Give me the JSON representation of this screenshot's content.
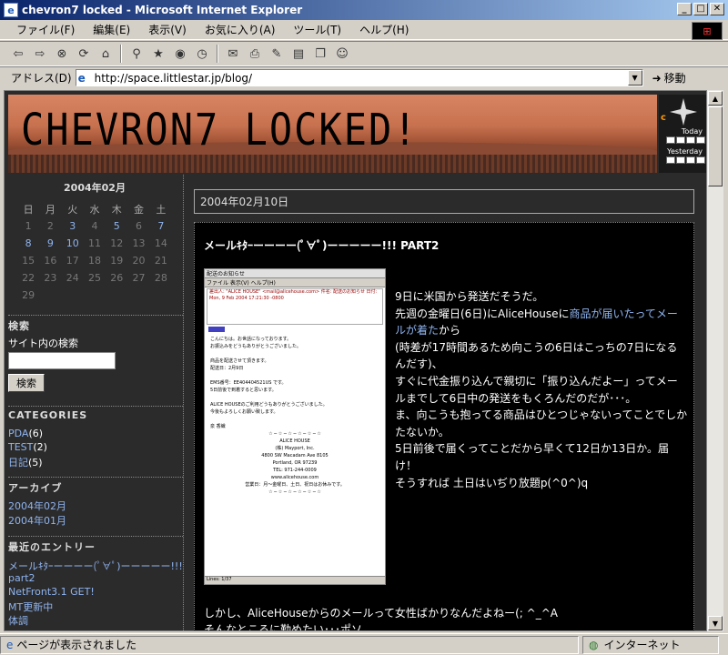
{
  "window": {
    "title": "chevron7 locked - Microsoft Internet Explorer"
  },
  "menu": [
    "ファイル(F)",
    "編集(E)",
    "表示(V)",
    "お気に入り(A)",
    "ツール(T)",
    "ヘルプ(H)"
  ],
  "address": {
    "label": "アドレス(D)",
    "url": "http://space.littlestar.jp/blog/",
    "go": "移動"
  },
  "blog": {
    "title": "CHEVRON7 LOCKED!",
    "counter_today": "Today",
    "counter_yesterday": "Yesterday",
    "calendar": {
      "title": "2004年02月",
      "weekdays": [
        "日",
        "月",
        "火",
        "水",
        "木",
        "金",
        "土"
      ],
      "weeks": [
        [
          "1",
          "2",
          "3",
          "4",
          "5",
          "6",
          "7"
        ],
        [
          "8",
          "9",
          "10",
          "11",
          "12",
          "13",
          "14"
        ],
        [
          "15",
          "16",
          "17",
          "18",
          "19",
          "20",
          "21"
        ],
        [
          "22",
          "23",
          "24",
          "25",
          "26",
          "27",
          "28"
        ],
        [
          "29",
          "",
          "",
          "",
          "",
          "",
          ""
        ]
      ],
      "linked_days": [
        "3",
        "5",
        "7",
        "8",
        "9",
        "10"
      ]
    },
    "search": {
      "heading": "検索",
      "label": "サイト内の検索",
      "button": "検索"
    },
    "categories": {
      "heading": "CATEGORIES",
      "items": [
        {
          "name": "PDA",
          "count": "(6)"
        },
        {
          "name": "TEST",
          "count": "(2)"
        },
        {
          "name": "日記",
          "count": "(5)"
        }
      ]
    },
    "archive": {
      "heading": "アーカイブ",
      "items": [
        "2004年02月",
        "2004年01月"
      ]
    },
    "recent": {
      "heading": "最近のエントリー",
      "items": [
        "メールｷﾀｰーーーー(ﾟ∀ﾟ)ーーーーー!!!",
        "part2",
        "NetFront3.1 GET!",
        "MT更新中",
        "体調"
      ]
    },
    "post": {
      "date": "2004年02月10日",
      "title": "メールｷﾀｰーーーー(ﾟ∀ﾟ)ーーーーー!!! PART2",
      "lines": [
        "9日に米国から発送だそうだ。",
        "先週の金曜日(6日)にAliceHouseに",
        "商品が届いたってメールが着た",
        "から",
        "(時差が17時間あるため向こうの6日はこっちの7日になるんだす)、",
        "すぐに代金振り込んで親切に「振り込んだよー」ってメールまでして6日中の発送をもくろんだのだが･･･。",
        "ま、向こうも抱ってる商品はひとつじゃないってことでしかたないか。",
        "5日前後で届くってことだから早くて12日か13日か。届け！",
        "そうすれば 土日はいぢり放題p(^0^)q"
      ],
      "bottom1": "しかし、AliceHouseからのメールって女性ばかりなんだよねー(; ^_^A",
      "bottom2": "そんなところに勤めたい･･･ポソ"
    },
    "screenshot": {
      "title": "配送のお知らせ",
      "menu": "ファイル  表示(V)  ヘルプ(H)",
      "header": "差出人: \"ALICE HOUSE\" <mail@alicehouse.com>  件名: 配送のお知らせ  日付: Mon, 9 Feb 2004 17:21:30 -0800",
      "body1": "こんにちは。お世話になっております。",
      "body2": "お振込みをどうもありがとうございました。",
      "body3": "商品を配送させて頂きます。",
      "body4": "配送日：2月9日",
      "body5": "EMS番号：EE404404521US です。",
      "body6": "5日前後で到着すると思います。",
      "body7": "ALICE HOUSEのご利用どうもありがとうございました。",
      "body8": "今後もよろしくお願い致します。",
      "sign1": "泉 香織",
      "sign2": "ALICE HOUSE",
      "sign3": "(株) Mayport, Inc.",
      "sign4": "4800 SW Macadam Ave 8105",
      "sign5": "Portland, OR 97239",
      "sign6": "TEL: 971-244-0009",
      "sign7": "www.alicehouse.com",
      "sign8": "営業日：月～金曜日、土日、祝日はお休みです。",
      "lines": "Lines: 1/37"
    }
  },
  "status": {
    "left": "ページが表示されました",
    "right": "インターネット"
  }
}
